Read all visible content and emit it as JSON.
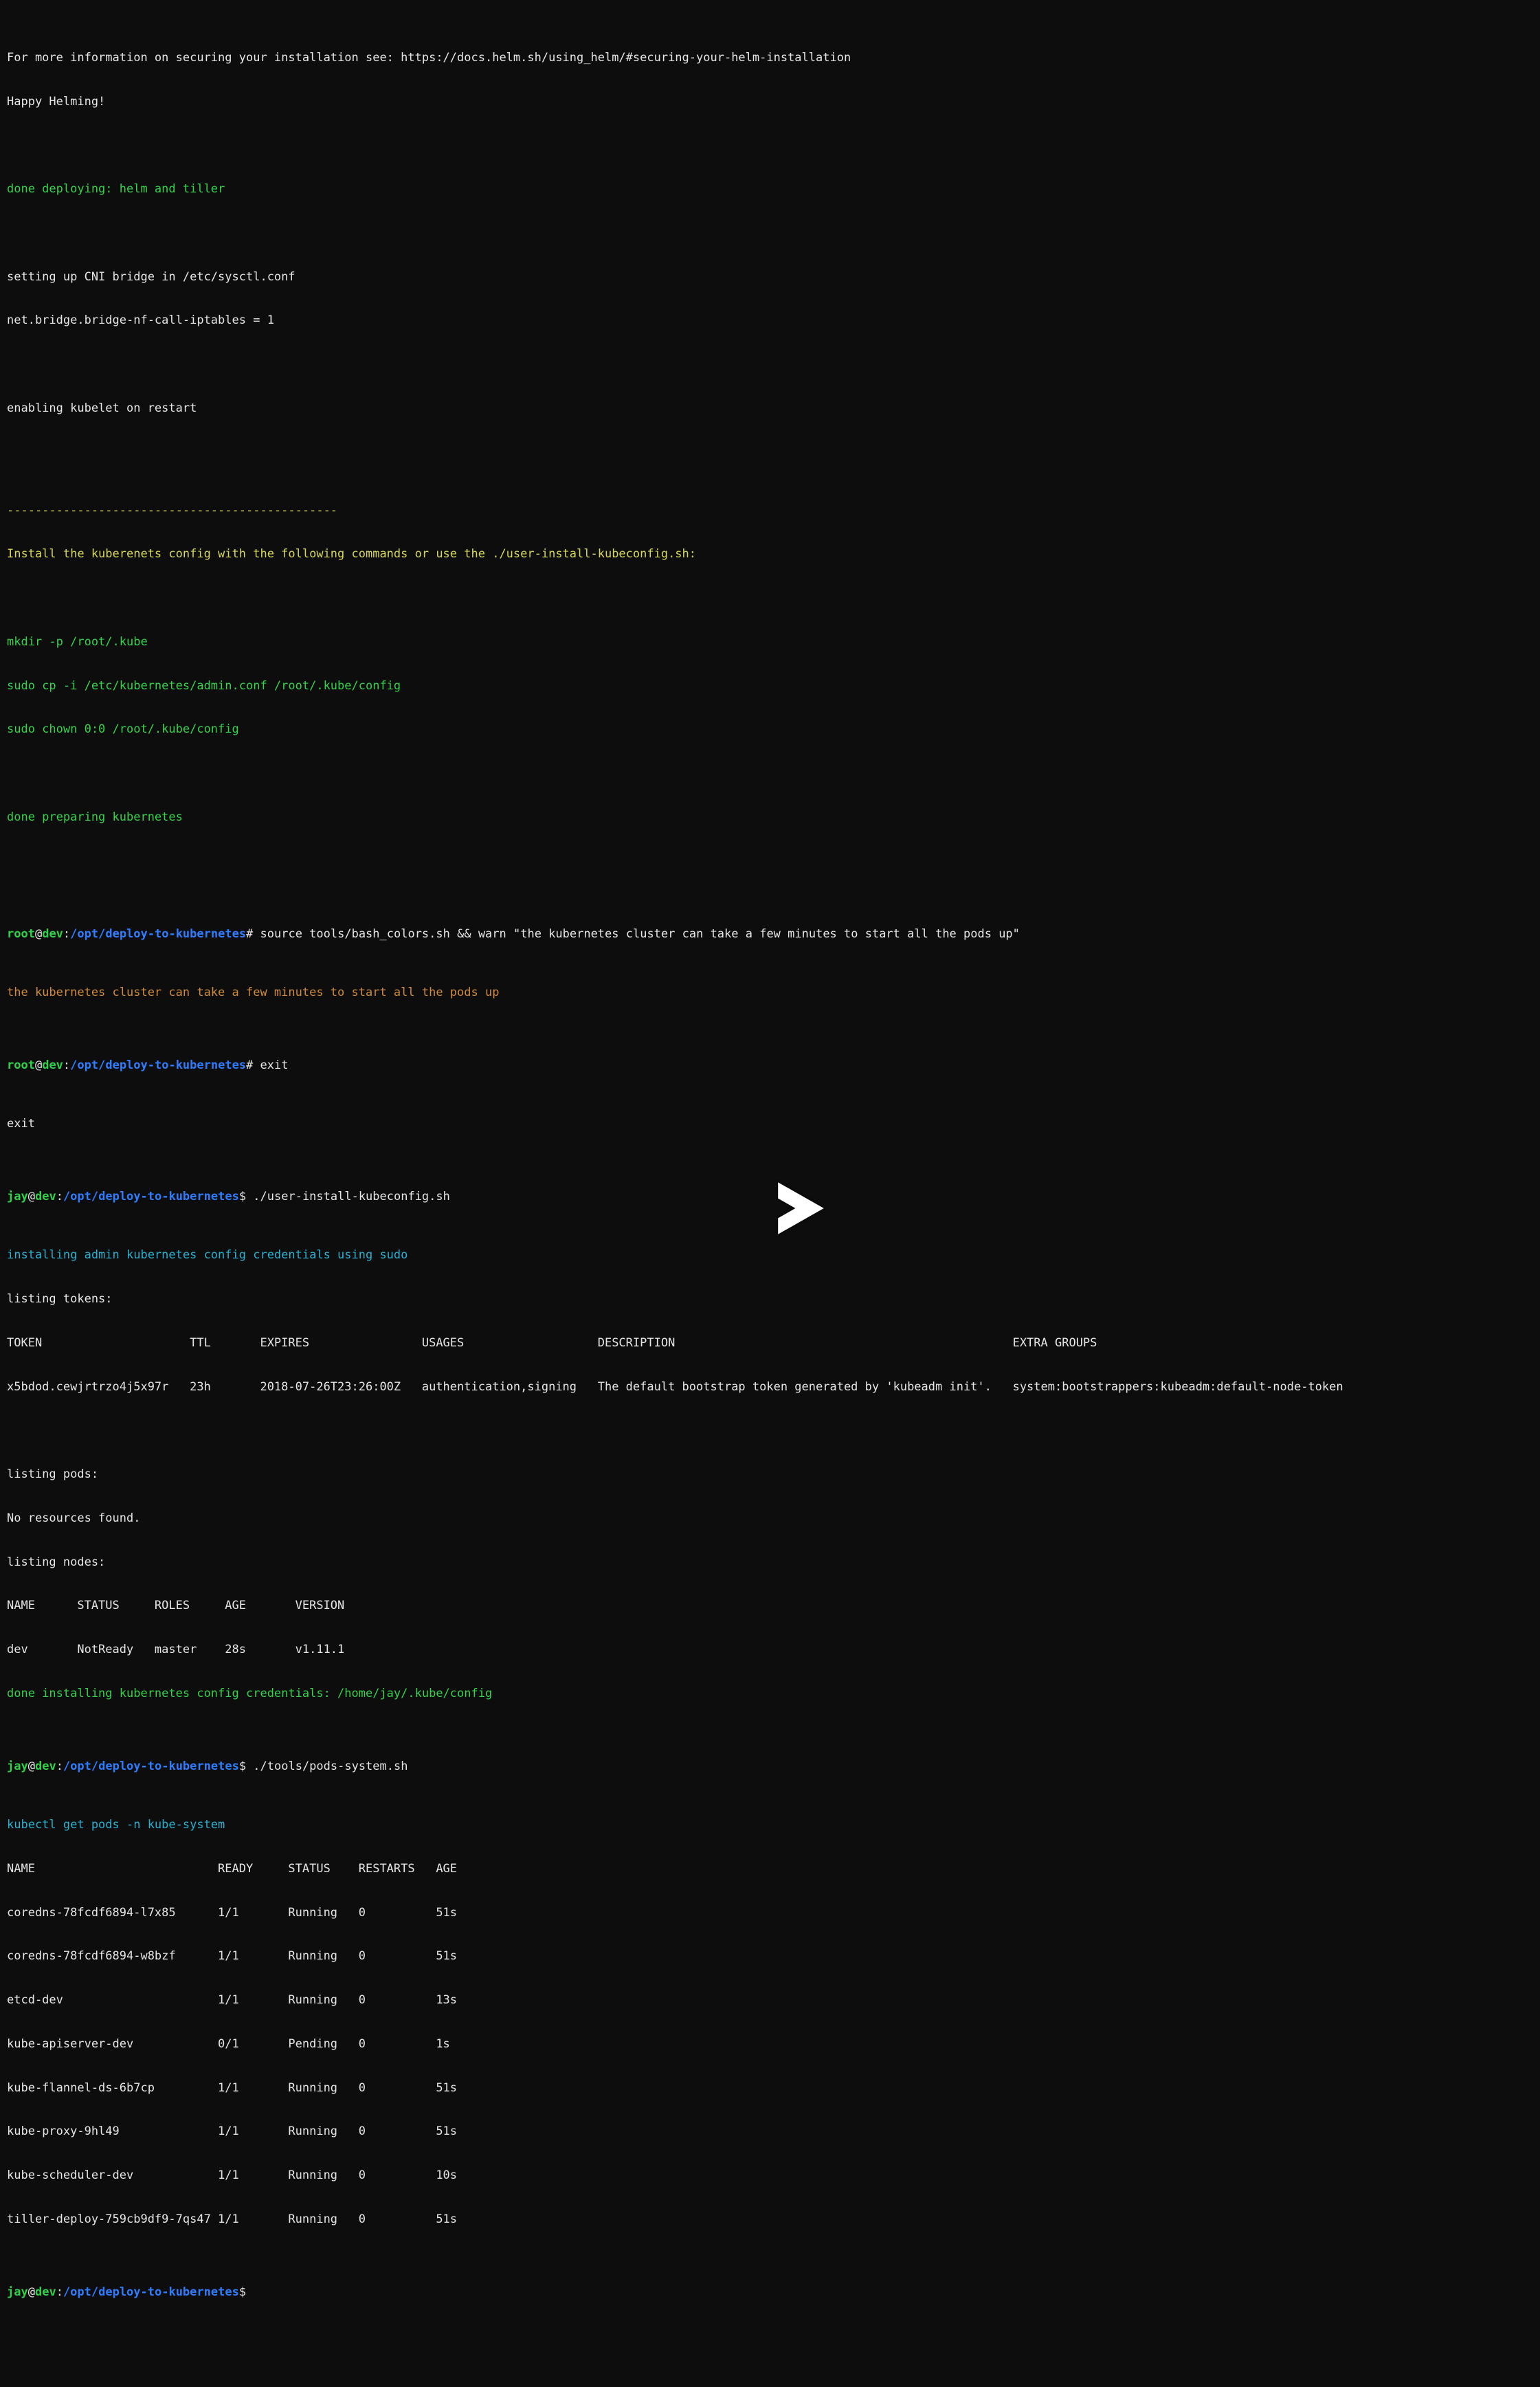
{
  "intro": {
    "l1": "For more information on securing your installation see: https://docs.helm.sh/using_helm/#securing-your-helm-installation",
    "l2": "Happy Helming!",
    "l3": "",
    "deploy_done": "done deploying: helm and tiller",
    "l5": "",
    "cni1": "setting up CNI bridge in /etc/sysctl.conf",
    "cni2": "net.bridge.bridge-nf-call-iptables = 1",
    "l8": "",
    "kubelet": "enabling kubelet on restart",
    "l10": ""
  },
  "instruct": {
    "rule": "-----------------------------------------------",
    "msg": "Install the kuberenets config with the following commands or use the ./user-install-kubeconfig.sh:",
    "blank1": "",
    "cmd1": "mkdir -p /root/.kube",
    "cmd2": "sudo cp -i /etc/kubernetes/admin.conf /root/.kube/config",
    "cmd3": "sudo chown 0:0 /root/.kube/config",
    "blank2": "",
    "done": "done preparing kubernetes",
    "blank3": ""
  },
  "prompts": {
    "root_user": "root",
    "jay_user": "jay",
    "at": "@",
    "host": "dev",
    "colon": ":",
    "path": "/opt/deploy-to-kubernetes",
    "root_sigil": "#",
    "jay_sigil": "$",
    "cmd_warn": " source tools/bash_colors.sh && warn \"the kubernetes cluster can take a few minutes to start all the pods up\"",
    "cmd_exit": " exit",
    "cmd_user_install": " ./user-install-kubeconfig.sh",
    "cmd_pods_system": " ./tools/pods-system.sh",
    "cmd_blank": " "
  },
  "warn_echo": "the kubernetes cluster can take a few minutes to start all the pods up",
  "exit_echo": "exit",
  "install": {
    "msg": "installing admin kubernetes config credentials using sudo",
    "listing_tokens": "listing tokens:",
    "tokens_header": "TOKEN                     TTL       EXPIRES                USAGES                   DESCRIPTION                                                EXTRA GROUPS",
    "tokens_row": "x5bdod.cewjrtrzo4j5x97r   23h       2018-07-26T23:26:00Z   authentication,signing   The default bootstrap token generated by 'kubeadm init'.   system:bootstrappers:kubeadm:default-node-token",
    "blank": "",
    "listing_pods": "listing pods:",
    "no_resources": "No resources found.",
    "listing_nodes": "listing nodes:",
    "nodes_header": "NAME      STATUS     ROLES     AGE       VERSION",
    "nodes_row": "dev       NotReady   master    28s       v1.11.1",
    "done": "done installing kubernetes config credentials: /home/jay/.kube/config"
  },
  "pods": {
    "cmd_echo": "kubectl get pods -n kube-system",
    "header": "NAME                          READY     STATUS    RESTARTS   AGE",
    "rows": [
      "coredns-78fcdf6894-l7x85      1/1       Running   0          51s",
      "coredns-78fcdf6894-w8bzf      1/1       Running   0          51s",
      "etcd-dev                      1/1       Running   0          13s",
      "kube-apiserver-dev            0/1       Pending   0          1s",
      "kube-flannel-ds-6b7cp         1/1       Running   0          51s",
      "kube-proxy-9hl49              1/1       Running   0          51s",
      "kube-scheduler-dev            1/1       Running   0          10s",
      "tiller-deploy-759cb9df9-7qs47 1/1       Running   0          51s"
    ]
  },
  "chart_data": {
    "type": "table",
    "title": "kubectl get pods -n kube-system",
    "columns": [
      "NAME",
      "READY",
      "STATUS",
      "RESTARTS",
      "AGE"
    ],
    "rows": [
      [
        "coredns-78fcdf6894-l7x85",
        "1/1",
        "Running",
        0,
        "51s"
      ],
      [
        "coredns-78fcdf6894-w8bzf",
        "1/1",
        "Running",
        0,
        "51s"
      ],
      [
        "etcd-dev",
        "1/1",
        "Running",
        0,
        "13s"
      ],
      [
        "kube-apiserver-dev",
        "0/1",
        "Pending",
        0,
        "1s"
      ],
      [
        "kube-flannel-ds-6b7cp",
        "1/1",
        "Running",
        0,
        "51s"
      ],
      [
        "kube-proxy-9hl49",
        "1/1",
        "Running",
        0,
        "51s"
      ],
      [
        "kube-scheduler-dev",
        "1/1",
        "Running",
        0,
        "10s"
      ],
      [
        "tiller-deploy-759cb9df9-7qs47",
        "1/1",
        "Running",
        0,
        "51s"
      ]
    ]
  },
  "colors": {
    "bg": "#0d0d0d",
    "fg": "#e6e6e6",
    "green": "#35d24a",
    "yellow": "#d6d65a",
    "orange": "#d08a3a",
    "cyan": "#29b0d0",
    "blue": "#2f7dff"
  }
}
